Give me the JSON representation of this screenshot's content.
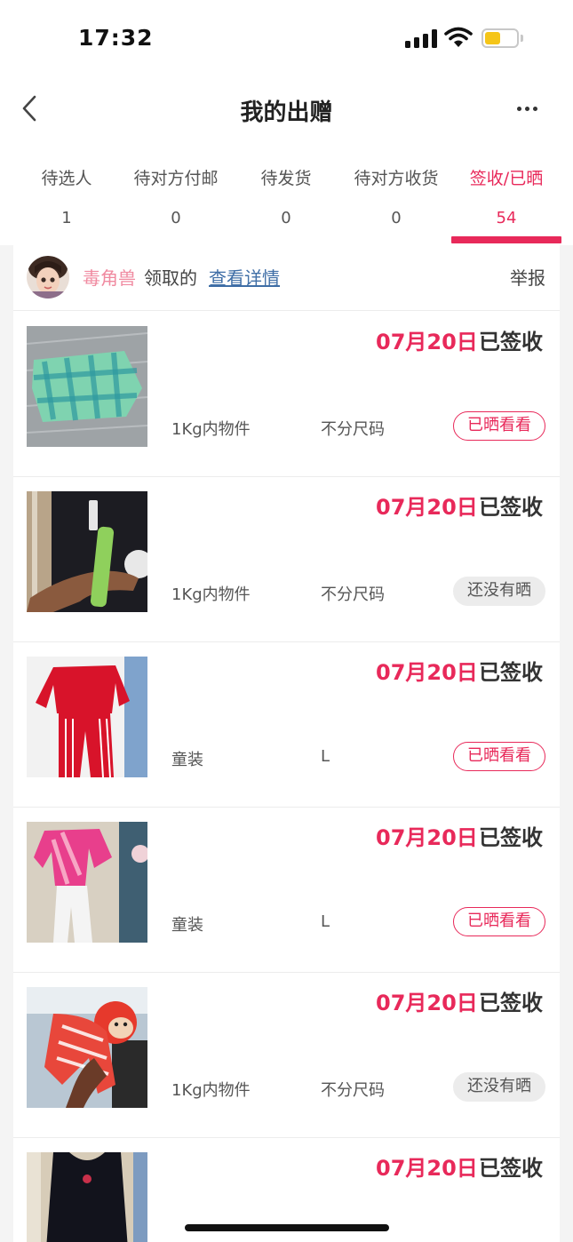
{
  "status_bar": {
    "time": "17:32",
    "battery_level": 0.5
  },
  "header": {
    "title": "我的出赠"
  },
  "tabs": [
    {
      "label": "待选人",
      "count": "1"
    },
    {
      "label": "待对方付邮",
      "count": "0"
    },
    {
      "label": "待发货",
      "count": "0"
    },
    {
      "label": "待对方收货",
      "count": "0"
    },
    {
      "label": "签收/已晒",
      "count": "54"
    }
  ],
  "active_tab": 4,
  "receiver": {
    "name": "毒角兽",
    "action_text": "领取的",
    "detail_link": "查看详情",
    "report_label": "举报"
  },
  "items": [
    {
      "date": "07月20日",
      "status": "已签收",
      "category": "1Kg内物件",
      "size": "不分尺码",
      "badge": "已晒看看",
      "photo_icon": "green-plaid-cloth"
    },
    {
      "date": "07月20日",
      "status": "已签收",
      "category": "1Kg内物件",
      "size": "不分尺码",
      "badge": "还没有晒",
      "photo_icon": "selfie-stick"
    },
    {
      "date": "07月20日",
      "status": "已签收",
      "category": "童装",
      "size": "L",
      "badge": "已晒看看",
      "photo_icon": "red-tracksuit"
    },
    {
      "date": "07月20日",
      "status": "已签收",
      "category": "童装",
      "size": "L",
      "badge": "已晒看看",
      "photo_icon": "pink-outfit"
    },
    {
      "date": "07月20日",
      "status": "已签收",
      "category": "1Kg内物件",
      "size": "不分尺码",
      "badge": "还没有晒",
      "photo_icon": "monkey-plush"
    },
    {
      "date": "07月20日",
      "status": "已签收",
      "photo_icon": "black-dress"
    }
  ],
  "colors": {
    "accent": "#e8295a",
    "link": "#3f6ea6",
    "receiver_name": "#f08aa0"
  }
}
